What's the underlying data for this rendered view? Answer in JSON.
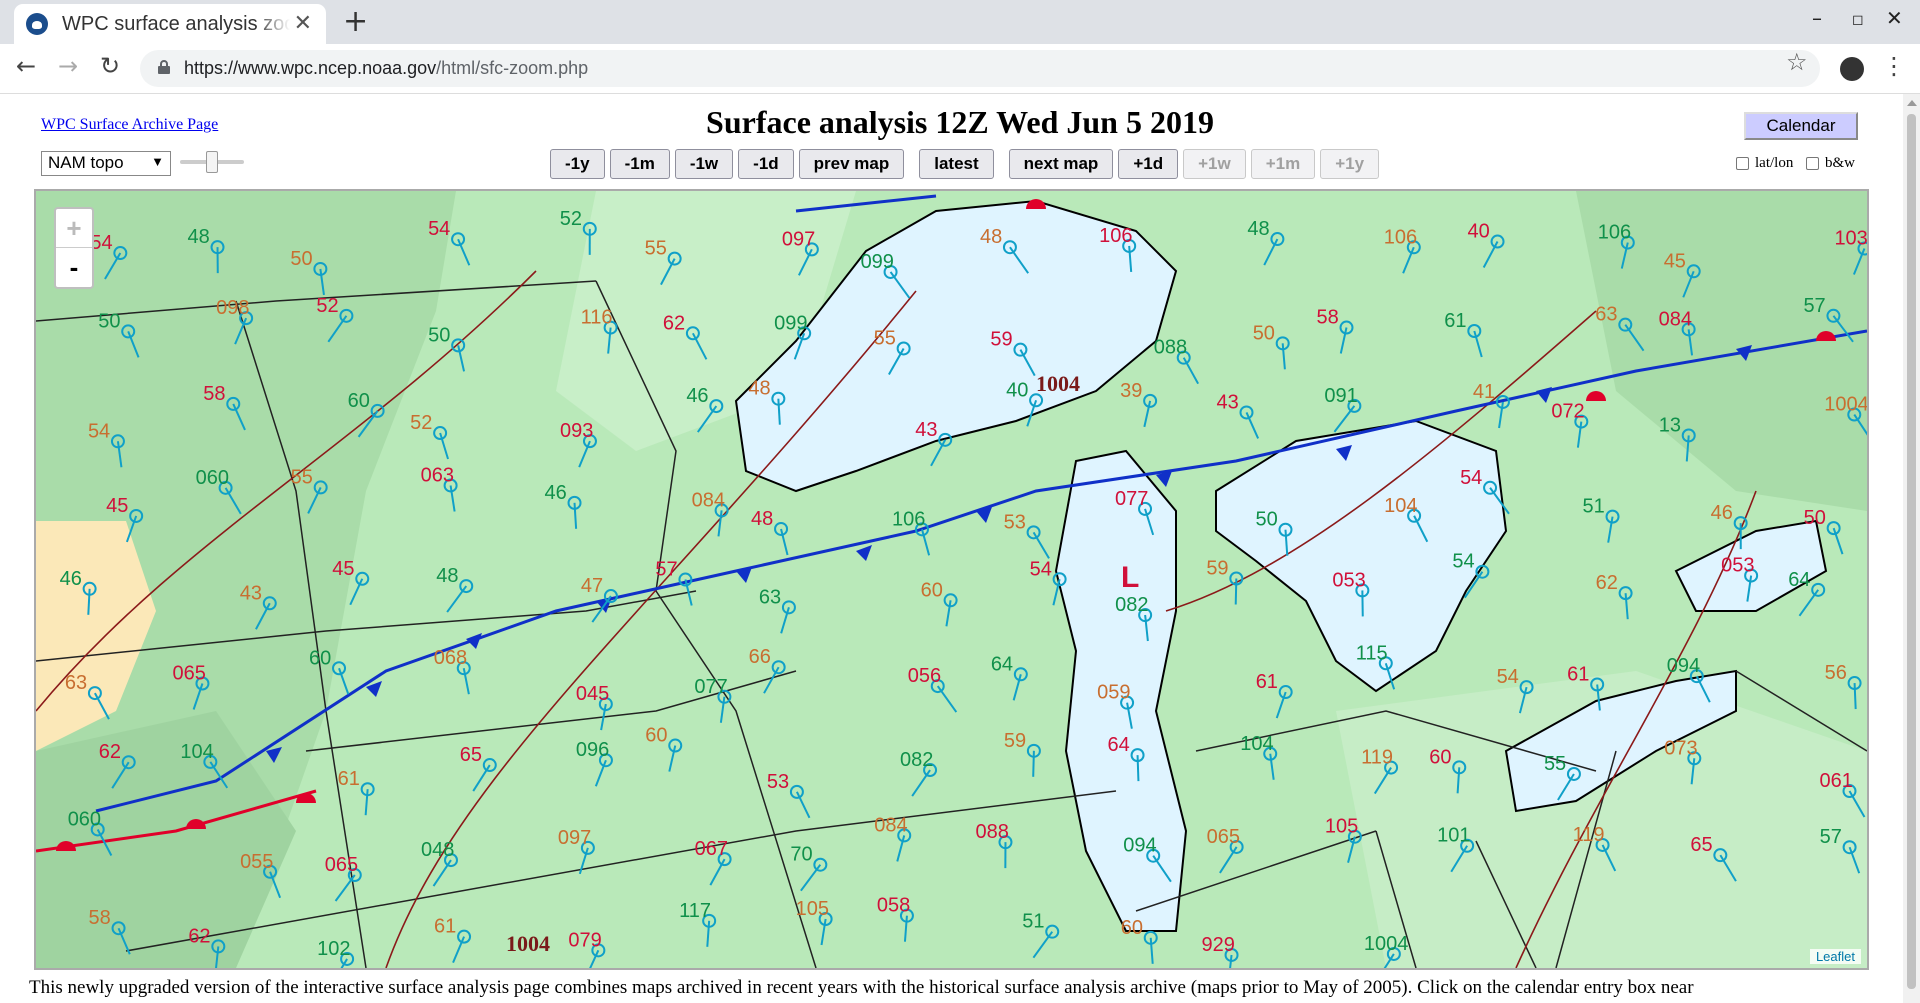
{
  "browser": {
    "tab_title": "WPC surface analysis zoom",
    "url_host": "https://www.wpc.ncep.noaa.gov",
    "url_path": "/html/sfc-zoom.php"
  },
  "page": {
    "archive_link": "WPC Surface Archive Page",
    "title": "Surface analysis 12Z Wed Jun 5 2019",
    "calendar_label": "Calendar",
    "layer_select": "NAM topo",
    "nav_buttons": [
      "-1y",
      "-1m",
      "-1w",
      "-1d",
      "prev map",
      "latest",
      "next map",
      "+1d",
      "+1w",
      "+1m",
      "+1y"
    ],
    "disabled_buttons": [
      "+1w",
      "+1m",
      "+1y"
    ],
    "checkbox_latlon": "lat/lon",
    "checkbox_bw": "b&w",
    "description": "This newly upgraded version of the interactive surface analysis page combines maps archived in recent years with the historical surface analysis archive (maps prior to May of 2005). Click on the calendar entry box near"
  },
  "map": {
    "zoom_in": "+",
    "zoom_out": "-",
    "attribution": "Leaflet",
    "pressure_labels": [
      "1004",
      "1004"
    ],
    "station_values": [
      "54",
      "48",
      "50",
      "54",
      "52",
      "55",
      "097",
      "099",
      "48",
      "106",
      "48",
      "106",
      "40",
      "106",
      "45",
      "103",
      "50",
      "098",
      "52",
      "50",
      "116",
      "62",
      "099",
      "55",
      "59",
      "088",
      "50",
      "58",
      "61",
      "63",
      "084",
      "57",
      "54",
      "58",
      "60",
      "52",
      "093",
      "46",
      "48",
      "43",
      "40",
      "39",
      "43",
      "091",
      "41",
      "072",
      "13",
      "1004",
      "45",
      "060",
      "55",
      "063",
      "46",
      "084",
      "48",
      "106",
      "53",
      "077",
      "50",
      "104",
      "54",
      "51",
      "46",
      "50",
      "46",
      "43",
      "45",
      "48",
      "47",
      "57",
      "63",
      "60",
      "54",
      "082",
      "59",
      "053",
      "54",
      "62",
      "053",
      "64",
      "63",
      "065",
      "60",
      "068",
      "045",
      "077",
      "66",
      "056",
      "64",
      "059",
      "61",
      "115",
      "54",
      "61",
      "094",
      "56",
      "62",
      "104",
      "61",
      "65",
      "096",
      "60",
      "53",
      "082",
      "59",
      "64",
      "104",
      "119",
      "60",
      "55",
      "073",
      "061",
      "060",
      "055",
      "065",
      "048",
      "097",
      "067",
      "70",
      "084",
      "088",
      "094",
      "065",
      "105",
      "101",
      "119",
      "65",
      "57",
      "58",
      "62",
      "102",
      "61",
      "079",
      "117",
      "105",
      "058",
      "51",
      "60",
      "929",
      "1004"
    ]
  },
  "colors": {
    "land": "#b9e9b9",
    "lake": "#dff4ff",
    "cold_front": "#1030c8",
    "warm_front": "#e0002a",
    "station_blue": "#10a0c8",
    "temp_red": "#d0103a",
    "dewpoint_green": "#10904a",
    "pressure_orange": "#c86e30"
  }
}
